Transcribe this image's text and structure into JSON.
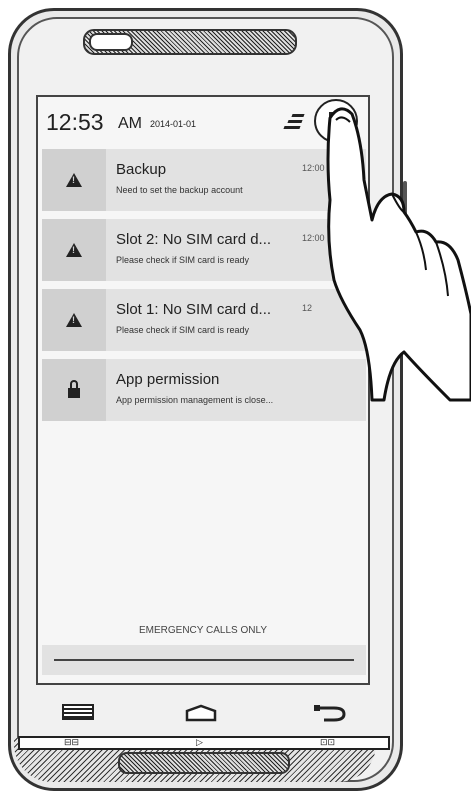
{
  "status_bar": {
    "time": "12:53",
    "ampm": "AM",
    "date": "2014-01-01"
  },
  "notifications": [
    {
      "title": "Backup",
      "subtitle": "Need to set the backup account",
      "time": "12:00",
      "icon": "warning-icon"
    },
    {
      "title": "Slot 2: No SIM card d...",
      "subtitle": "Please check if SIM card is ready",
      "time": "12:00",
      "icon": "warning-icon"
    },
    {
      "title": "Slot 1: No SIM card d...",
      "subtitle": "Please check if SIM card is ready",
      "time": "12",
      "icon": "warning-icon"
    },
    {
      "title": "App permission",
      "subtitle": "App permission management is close...",
      "time": "",
      "icon": "lock-icon"
    }
  ],
  "footer": {
    "emergency_text": "EMERGENCY CALLS ONLY"
  },
  "icons": {
    "clear_all": "clear-all-icon",
    "settings": "settings-grid-icon",
    "menu": "menu-icon",
    "home": "home-icon",
    "back": "back-icon"
  }
}
